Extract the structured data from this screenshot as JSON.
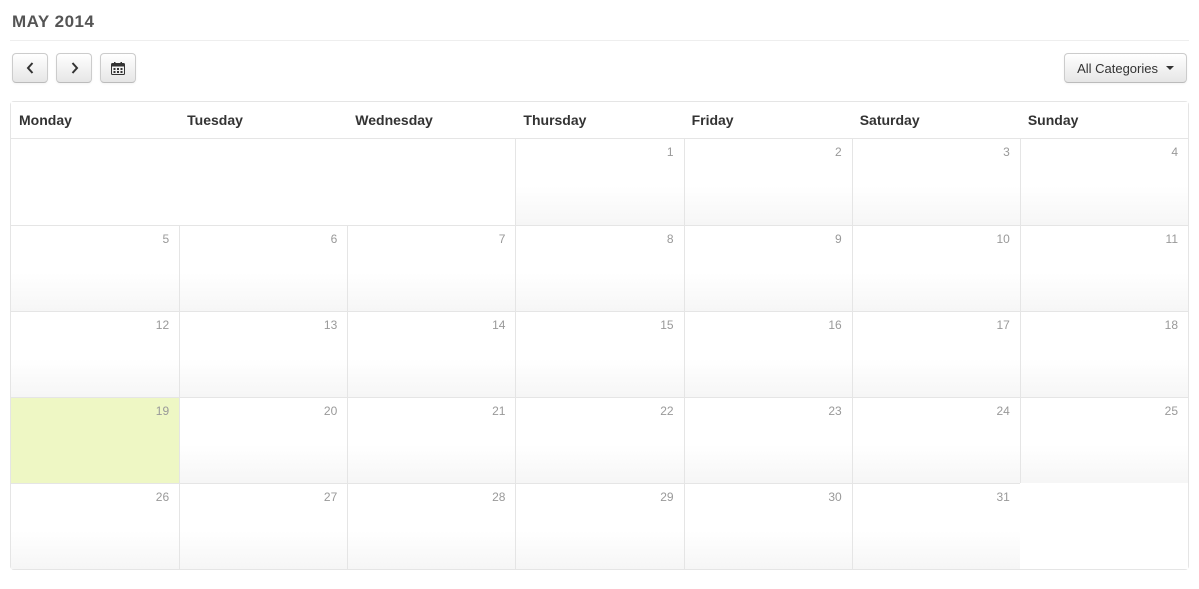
{
  "title": "MAY 2014",
  "toolbar": {
    "categories_label": "All Categories"
  },
  "weekdays": [
    "Monday",
    "Tuesday",
    "Wednesday",
    "Thursday",
    "Friday",
    "Saturday",
    "Sunday"
  ],
  "weeks": [
    [
      {
        "n": null,
        "blank": true
      },
      {
        "n": null,
        "blank": true
      },
      {
        "n": null,
        "blank": true
      },
      {
        "n": 1
      },
      {
        "n": 2
      },
      {
        "n": 3
      },
      {
        "n": 4
      }
    ],
    [
      {
        "n": 5
      },
      {
        "n": 6
      },
      {
        "n": 7
      },
      {
        "n": 8
      },
      {
        "n": 9
      },
      {
        "n": 10
      },
      {
        "n": 11
      }
    ],
    [
      {
        "n": 12
      },
      {
        "n": 13
      },
      {
        "n": 14
      },
      {
        "n": 15
      },
      {
        "n": 16
      },
      {
        "n": 17
      },
      {
        "n": 18
      }
    ],
    [
      {
        "n": 19,
        "today": true
      },
      {
        "n": 20
      },
      {
        "n": 21
      },
      {
        "n": 22
      },
      {
        "n": 23
      },
      {
        "n": 24
      },
      {
        "n": 25
      }
    ],
    [
      {
        "n": 26
      },
      {
        "n": 27
      },
      {
        "n": 28
      },
      {
        "n": 29
      },
      {
        "n": 30
      },
      {
        "n": 31
      },
      {
        "n": null,
        "blank": true
      }
    ]
  ]
}
